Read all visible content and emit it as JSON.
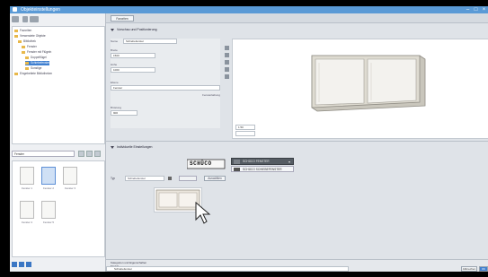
{
  "window": {
    "title": "Objekteinstellungen"
  },
  "left": {
    "tree": [
      {
        "label": "Favoriten",
        "depth": 0
      },
      {
        "label": "Verwendete Objekte",
        "depth": 0
      },
      {
        "label": "Bibliothek",
        "depth": 1
      },
      {
        "label": "Fenster",
        "depth": 2
      },
      {
        "label": "Fenster mit Flügeln",
        "depth": 2
      },
      {
        "label": "Doppelflügel",
        "depth": 3
      },
      {
        "label": "Schiebefenster",
        "depth": 3,
        "selected": true
      },
      {
        "label": "Sonstige",
        "depth": 3
      },
      {
        "label": "Eingebettete Bibliotheken",
        "depth": 0
      }
    ],
    "library_select": "Fenster",
    "thumbs": [
      "Fenster 1",
      "Fenster 2",
      "Fenster 3",
      "Fenster 4",
      "Fenster 5"
    ]
  },
  "right": {
    "tab_label": "Favoriten",
    "preview_section": "Vorschau und Positionierung",
    "props": {
      "name_label": "Name",
      "name_value": "Schiebefenster",
      "width_label": "Breite",
      "width_value": "1500",
      "height_label": "Höhe",
      "height_value": "1000",
      "layer_label": "Ebene",
      "layer_value": "Fenster",
      "sill_label": "Brüstung",
      "sill_value": "900",
      "anchor_label": "Fensterlaibung"
    },
    "scale_value": "1:50",
    "detail_section": "Individuelle Einstellungen",
    "logo_text": "SCHÜCO",
    "dropdown_value": "SCHÜCO FENSTER",
    "option2_value": "SCHÜCO SCHIEBEFENSTER",
    "ctrl_label": "Typ",
    "ctrl_value": "Schiebefenster",
    "ctrl_button": "Auswählen",
    "bottom": [
      "Kategorien und Eigenschaften",
      "Modell",
      "Klassifizierung und Eigenschaften"
    ],
    "cmd_input": "Schiebefenster",
    "cancel": "Abbrechen",
    "ok": "OK"
  },
  "colors": {
    "accent": "#3f7fd0",
    "frame": "#d9d6cc"
  }
}
